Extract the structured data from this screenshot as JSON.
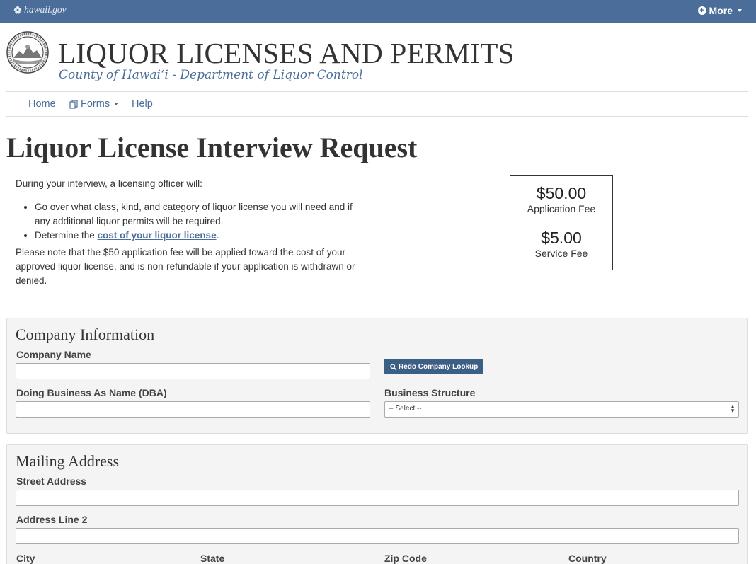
{
  "topbar": {
    "gov_label": "hawaii.gov",
    "more_label": "More"
  },
  "header": {
    "title": "LIQUOR LICENSES AND PERMITS",
    "subtitle": "County of Hawai‘i - Department of Liquor Control"
  },
  "nav": {
    "home": "Home",
    "forms": "Forms",
    "help": "Help"
  },
  "page": {
    "title": "Liquor License Interview Request",
    "intro": "During your interview, a licensing officer will:",
    "bullets": {
      "b1": "Go over what class, kind, and category of liquor license you will need and if any additional liquor permits will be required.",
      "b2_prefix": "Determine the ",
      "b2_link": "cost of your liquor license",
      "b2_suffix": "."
    },
    "note": "Please note that the $50 application fee will be applied toward the cost of your approved liquor license, and is non-refundable if your application is withdrawn or denied."
  },
  "fees": {
    "application_amount": "$50.00",
    "application_label": "Application Fee",
    "service_amount": "$5.00",
    "service_label": "Service Fee"
  },
  "company": {
    "heading": "Company Information",
    "name_label": "Company Name",
    "name_value": "",
    "lookup_button": "Redo Company Lookup",
    "dba_label": "Doing Business As Name (DBA)",
    "dba_value": "",
    "structure_label": "Business Structure",
    "structure_selected": "-- Select --"
  },
  "mailing": {
    "heading": "Mailing Address",
    "street_label": "Street Address",
    "street_value": "",
    "line2_label": "Address Line 2",
    "line2_value": "",
    "city_label": "City",
    "state_label": "State",
    "zip_label": "Zip Code",
    "country_label": "Country"
  },
  "colors": {
    "brand": "#4a6e99",
    "button": "#3c5f86",
    "panel_bg": "#f4f4f4"
  }
}
